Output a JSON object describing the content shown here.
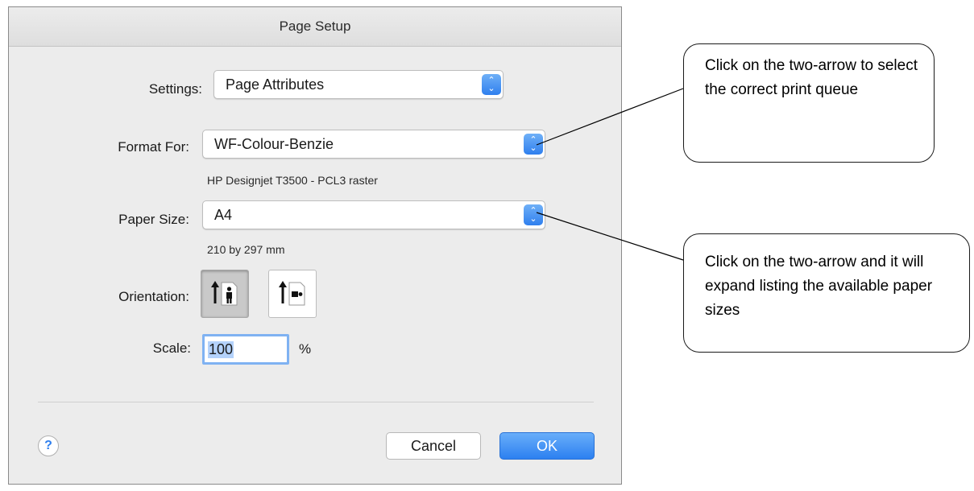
{
  "dialog": {
    "title": "Page Setup",
    "settings": {
      "label": "Settings:",
      "value": "Page Attributes"
    },
    "format_for": {
      "label": "Format For:",
      "value": "WF-Colour-Benzie",
      "subtitle": "HP Designjet T3500 - PCL3 raster"
    },
    "paper_size": {
      "label": "Paper Size:",
      "value": "A4",
      "subtitle": "210 by 297 mm"
    },
    "orientation": {
      "label": "Orientation:",
      "selected": "portrait"
    },
    "scale": {
      "label": "Scale:",
      "value": "100",
      "unit": "%"
    },
    "help_label": "?",
    "cancel_label": "Cancel",
    "ok_label": "OK"
  },
  "callouts": [
    {
      "text": "Click on the two-arrow to select the correct print queue"
    },
    {
      "text": "Click on the two-arrow and it will expand listing the available paper sizes"
    }
  ],
  "colors": {
    "accent": "#2f7fee",
    "dialog_bg": "#ececec"
  },
  "icons": [
    "chevron-updown-icon",
    "portrait-orientation-icon",
    "landscape-orientation-icon",
    "help-icon"
  ]
}
